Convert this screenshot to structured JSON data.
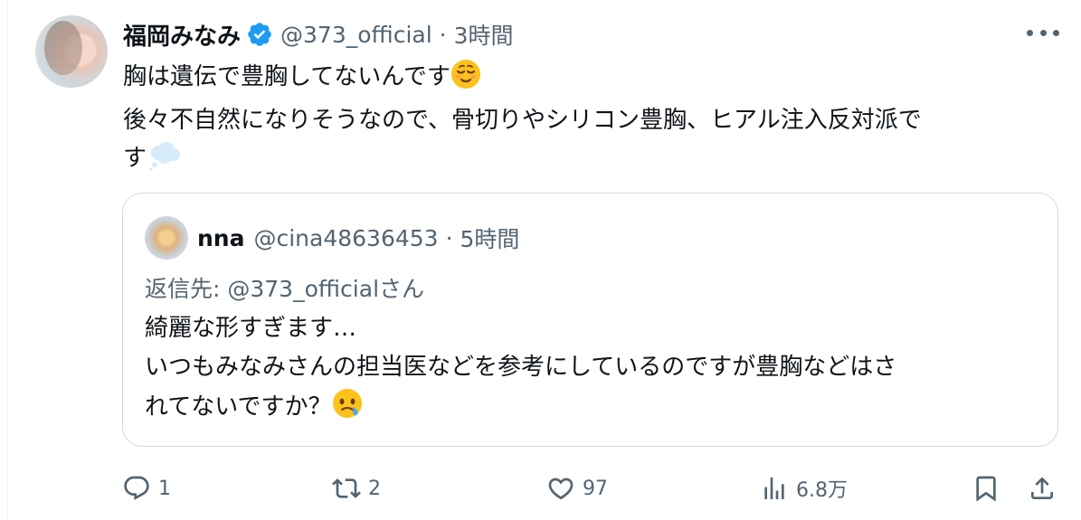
{
  "tweet": {
    "author_name": "福岡みなみ",
    "handle": "@373_official",
    "separator": "·",
    "time": "3時間",
    "verified": true,
    "lines": [
      "胸は遺伝で豊胸してないんです",
      "後々不自然になりそうなので、骨切りやシリコン豊胸、ヒアル注入反対派で",
      "す"
    ],
    "emojis": [
      "relieved-face-emoji",
      "thought-balloon-emoji"
    ]
  },
  "quote": {
    "author_name": "nna",
    "handle": "@cina48636453",
    "separator": "·",
    "time": "5時間",
    "reply_to": "返信先: @373_officialさん",
    "lines": [
      "綺麗な形すぎます…",
      "いつもみなみさんの担当医などを参考にしているのですが豊胸などはさ",
      "れてないですか？"
    ],
    "emoji": "face-holding-back-tears-emoji"
  },
  "actions": {
    "reply_count": "1",
    "retweet_count": "2",
    "like_count": "97",
    "views_count": "6.8万"
  },
  "colors": {
    "text": "#0f1419",
    "secondary": "#536471",
    "border": "#cfd9de",
    "verified": "#1d9bf0"
  }
}
